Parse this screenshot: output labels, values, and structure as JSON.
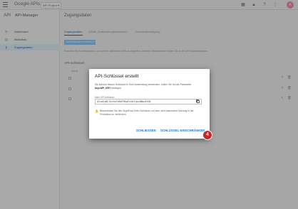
{
  "topbar": {
    "brand": "Google APIs",
    "project": "API Project ▾",
    "icons": [
      "apps-icon",
      "notifications-icon",
      "help-icon",
      "more-vert-icon"
    ],
    "avatar": "A"
  },
  "sidebar": {
    "logo": "API",
    "title": "API-Manager",
    "items": [
      {
        "label": "Dashboard",
        "icon": "dashboard-icon",
        "active": false
      },
      {
        "label": "Bibliothek",
        "icon": "library-icon",
        "active": false
      },
      {
        "label": "Zugangsdaten",
        "icon": "key-icon",
        "active": true
      }
    ]
  },
  "main": {
    "title": "Zugangsdaten",
    "tabs": [
      "Zugangsdaten",
      "OAuth-Zustimmungsbildschirm",
      "Domainbestätigung"
    ],
    "create_button": "Anmeldedaten erstellen ▾",
    "hint": "Erstellen Sie Anmeldedaten, um auf Ihre aktivierten APIs zuzugreifen. Weitere Informationen finden Sie in der API-Dokumentation.",
    "section_title": "API-Schlüssel",
    "col_name": "Name"
  },
  "dialog": {
    "title": "API-Schlüssel erstellt",
    "text_before": "Sie können diesen Schlüssel in Ihrer Anwendung verwenden, indem Sie ihn als Parameter ",
    "param": "key=API_KEY",
    "text_after": " festlegen.",
    "key_label": "Mein API-Schlüssel",
    "key_value": "AIzaSyBC7qrXsFe8aTRkpFxVo1lpu4Nbw3tQE",
    "warning": "Beschränken Sie den Zugriff auf Ihren Schlüssel, um eine nicht autorisierte Nutzung in der Produktion zu verhindern.",
    "close_button": "SCHLIESSEN",
    "restrict_button": "SCHLÜSSEL EINSCHRÄNKEN"
  },
  "step_badge": "4",
  "colors": {
    "accent": "#1976d2",
    "badge": "#c62828",
    "warning": "#f9a825"
  }
}
